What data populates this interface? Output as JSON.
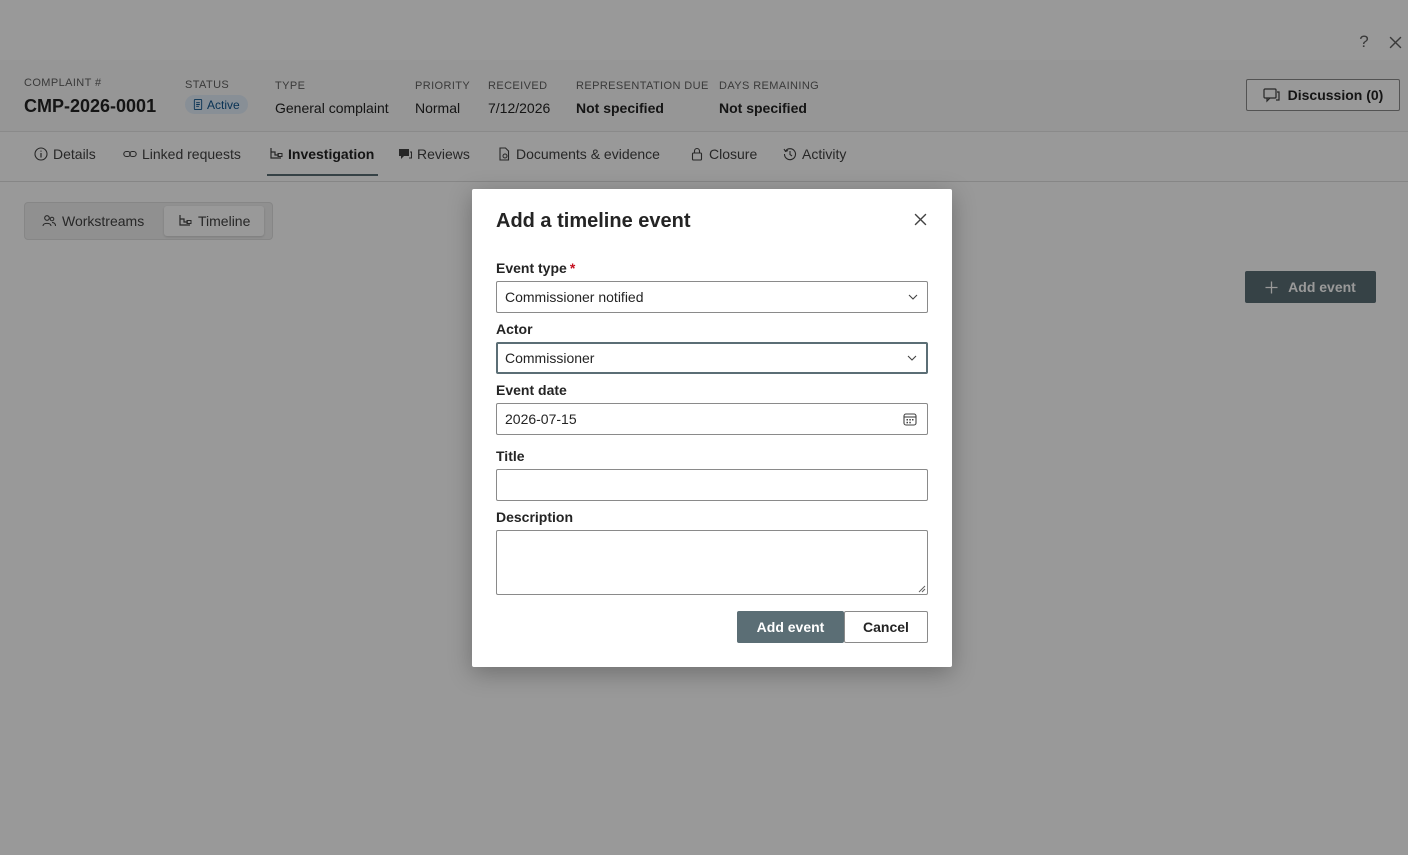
{
  "window": {
    "help_label": "?",
    "close_label": "✕"
  },
  "header": {
    "complaint": {
      "label": "Complaint #",
      "value": "CMP-2026-0001"
    },
    "status": {
      "label": "Status",
      "value": "Active"
    },
    "type": {
      "label": "Type",
      "value": "General complaint"
    },
    "priority": {
      "label": "Priority",
      "value": "Normal"
    },
    "received": {
      "label": "Received",
      "value": "7/12/2026"
    },
    "representation_due": {
      "label": "Representation due",
      "value": "Not specified"
    },
    "days_remaining": {
      "label": "Days remaining",
      "value": "Not specified"
    },
    "discussion_button": "Discussion (0)"
  },
  "tabs": [
    {
      "label": "Details",
      "icon": "info-icon"
    },
    {
      "label": "Linked requests",
      "icon": "link-icon"
    },
    {
      "label": "Investigation",
      "icon": "flow-icon",
      "active": true
    },
    {
      "label": "Reviews",
      "icon": "chat-icon"
    },
    {
      "label": "Documents & evidence",
      "icon": "document-icon"
    },
    {
      "label": "Closure",
      "icon": "lock-icon"
    },
    {
      "label": "Activity",
      "icon": "history-icon"
    }
  ],
  "subview": {
    "workstreams": "Workstreams",
    "timeline": "Timeline",
    "selected": "Timeline"
  },
  "page_add_event": "Add event",
  "dialog": {
    "title": "Add a timeline event",
    "event_type": {
      "label": "Event type",
      "required_mark": "*",
      "value": "Commissioner notified"
    },
    "actor": {
      "label": "Actor",
      "value": "Commissioner"
    },
    "event_date": {
      "label": "Event date",
      "value": "2026-07-15"
    },
    "title_field": {
      "label": "Title",
      "value": ""
    },
    "description": {
      "label": "Description",
      "value": ""
    },
    "submit": "Add event",
    "cancel": "Cancel"
  },
  "colors": {
    "accent": "#5b6e75",
    "badge_bg": "#e3eefb",
    "badge_text": "#0f548c",
    "required": "#c50f1f",
    "overlay": "rgba(0,0,0,0.40)"
  }
}
